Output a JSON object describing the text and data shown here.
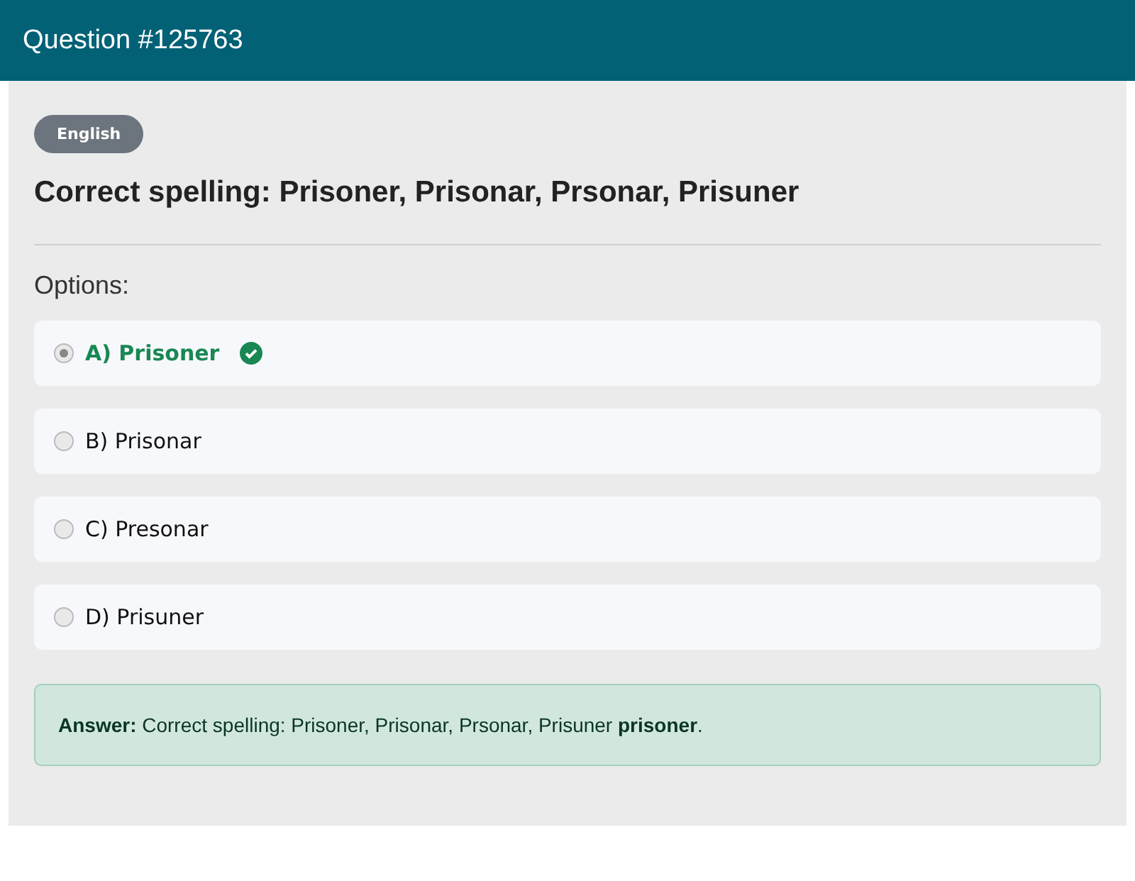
{
  "header": {
    "title": "Question #125763"
  },
  "category": {
    "label": "English"
  },
  "question": "Correct spelling: Prisoner, Prisonar, Prsonar, Prisuner",
  "options_label": "Options:",
  "options": [
    {
      "label": "A) Prisoner",
      "selected": true,
      "correct": true
    },
    {
      "label": "B) Prisonar",
      "selected": false,
      "correct": false
    },
    {
      "label": "C) Presonar",
      "selected": false,
      "correct": false
    },
    {
      "label": "D) Prisuner",
      "selected": false,
      "correct": false
    }
  ],
  "answer": "**Answer:** Correct spelling: Prisoner, Prisonar, Prsonar, Prisuner **prisoner**."
}
